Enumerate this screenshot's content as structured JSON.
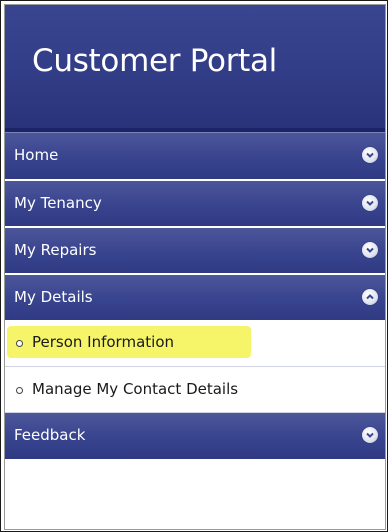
{
  "header": {
    "title": "Customer Portal"
  },
  "menu": {
    "items": [
      {
        "label": "Home",
        "icon": "chevron-down-icon"
      },
      {
        "label": "My Tenancy",
        "icon": "chevron-down-icon"
      },
      {
        "label": "My Repairs",
        "icon": "chevron-down-icon"
      },
      {
        "label": "My Details",
        "icon": "chevron-up-icon",
        "expanded": true
      },
      {
        "label": "Feedback",
        "icon": "chevron-down-icon"
      }
    ],
    "details_submenu": [
      {
        "label": "Person Information",
        "highlighted": true
      },
      {
        "label": "Manage My Contact Details"
      }
    ]
  },
  "colors": {
    "header_bg": "#323d87",
    "menu_bg": "#3a4590",
    "highlight": "#f6f56a",
    "text_light": "#ffffff"
  }
}
